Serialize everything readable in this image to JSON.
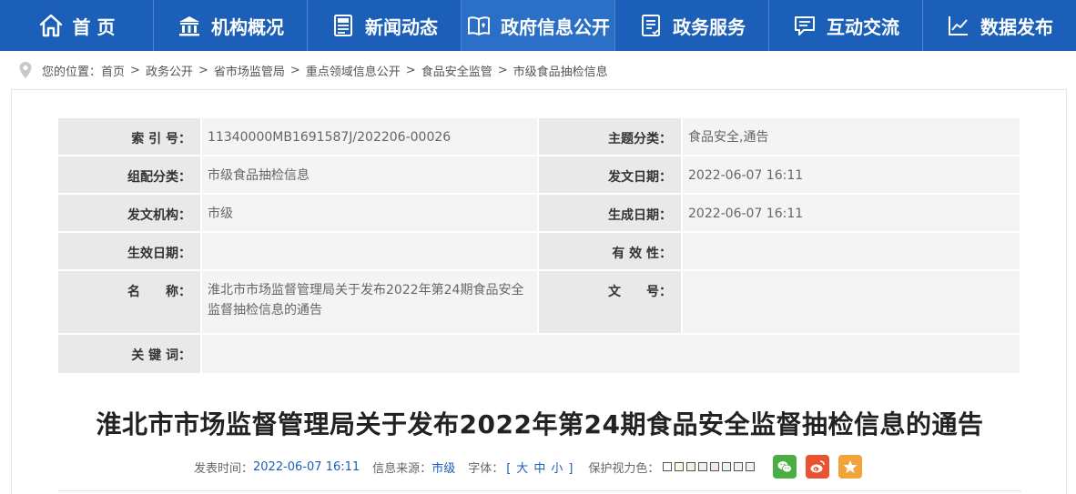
{
  "nav": {
    "items": [
      {
        "label": "首 页",
        "icon": "home-icon"
      },
      {
        "label": "机构概况",
        "icon": "building-icon"
      },
      {
        "label": "新闻动态",
        "icon": "news-icon"
      },
      {
        "label": "政府信息公开",
        "icon": "book-icon"
      },
      {
        "label": "政务服务",
        "icon": "clipboard-icon"
      },
      {
        "label": "互动交流",
        "icon": "chat-icon"
      },
      {
        "label": "数据发布",
        "icon": "chart-icon"
      }
    ],
    "active_index": 3,
    "colors": {
      "bar": "#1b5fb8",
      "active": "#2b6fc6"
    }
  },
  "breadcrumb": {
    "prefix": "您的位置：",
    "items": [
      "首页",
      "政务公开",
      "省市场监管局",
      "重点领域信息公开",
      "食品安全监管",
      "市级食品抽检信息"
    ],
    "separator": ">"
  },
  "meta": {
    "index_label": "索 引 号：",
    "index_value": "11340000MB1691587J/202206-00026",
    "topic_label": "主题分类：",
    "topic_value": "食品安全,通告",
    "group_label": "组配分类：",
    "group_value": "市级食品抽检信息",
    "issue_date_label": "发文日期：",
    "issue_date_value": "2022-06-07 16:11",
    "issuer_label": "发文机构：",
    "issuer_value": "市级",
    "created_label": "生成日期：",
    "created_value": "2022-06-07 16:11",
    "effective_label": "生效日期：",
    "effective_value": "",
    "validity_label": "有 效 性：",
    "validity_value": "",
    "name_label": "名　　称：",
    "name_value": "淮北市市场监督管理局关于发布2022年第24期食品安全监督抽检信息的通告",
    "docno_label": "文　　号：",
    "docno_value": "",
    "keywords_label": "关 键 词：",
    "keywords_value": ""
  },
  "article": {
    "title": "淮北市市场监督管理局关于发布2022年第24期食品安全监督抽检信息的通告"
  },
  "info": {
    "publish_label": "发表时间：",
    "publish_value": "2022-06-07 16:11",
    "source_label": "信息来源：",
    "source_value": "市级",
    "font_label": "字体：",
    "font_open": "[",
    "font_large": "大",
    "font_medium": "中",
    "font_small": "小",
    "font_close": "]",
    "eye_label": "保护视力色：",
    "swatch_colors": [
      "#ffffff",
      "#fafae0",
      "#f5efdf",
      "#eef0f6",
      "#f4e8f0",
      "#eaf6ea",
      "#edf2f2",
      "#f2f2f2"
    ]
  },
  "share": {
    "icons": [
      "wechat-icon",
      "weibo-icon",
      "favorite-icon"
    ]
  }
}
